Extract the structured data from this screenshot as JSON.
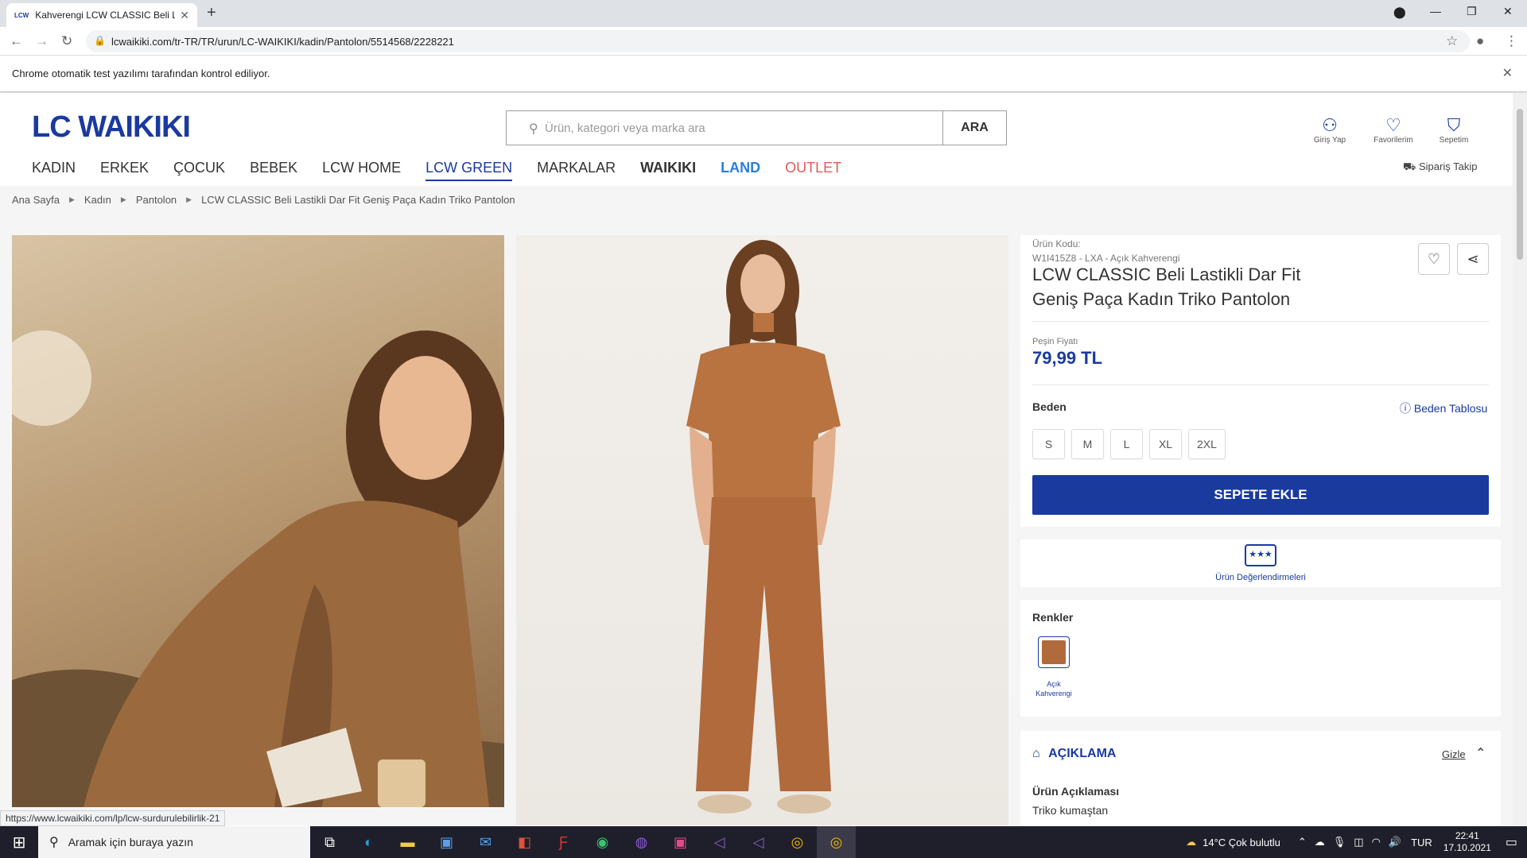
{
  "browser": {
    "tab_title": "Kahverengi LCW CLASSIC Beli La",
    "tab_favicon": "LCW",
    "url": "lcwaikiki.com/tr-TR/TR/urun/LC-WAIKIKI/kadin/Pantolon/5514568/2228221",
    "automation_notice": "Chrome otomatik test yazılımı tarafından kontrol ediliyor.",
    "status_url": "https://www.lcwaikiki.com/lp/lcw-surdurulebilirlik-21"
  },
  "header": {
    "logo": "LC WAIKIKI",
    "search_placeholder": "Ürün, kategori veya marka ara",
    "search_button": "ARA",
    "login_label": "Giriş Yap",
    "favorites_label": "Favorilerim",
    "cart_label": "Sepetim",
    "order_track_label": "Sipariş Takip"
  },
  "nav": {
    "items": [
      "KADIN",
      "ERKEK",
      "ÇOCUK",
      "BEBEK",
      "LCW HOME",
      "LCW GREEN",
      "MARKALAR"
    ],
    "waikiki": "WAIKIKI",
    "land": "LAND",
    "outlet": "OUTLET"
  },
  "breadcrumb": [
    "Ana Sayfa",
    "Kadın",
    "Pantolon",
    "LCW CLASSIC Beli Lastikli Dar Fit Geniş Paça Kadın Triko Pantolon"
  ],
  "product": {
    "code_label": "Ürün Kodu:",
    "code_value": "W1I415Z8 - LXA - Açık Kahverengi",
    "title": "LCW CLASSIC Beli Lastikli Dar Fit Geniş Paça Kadın Triko Pantolon",
    "price_label": "Peşin Fiyatı",
    "price": "79,99 TL",
    "size_label": "Beden",
    "size_table": "Beden Tablosu",
    "sizes": [
      "S",
      "M",
      "L",
      "XL",
      "2XL"
    ],
    "add_to_cart": "SEPETE EKLE",
    "reviews_label": "Ürün Değerlendirmeleri",
    "colors_label": "Renkler",
    "color_name_1": "Açık",
    "color_name_2": "Kahverengi",
    "swatch_color": "#b06a3c",
    "description_title": "AÇIKLAMA",
    "hide_label": "Gizle",
    "description_heading": "Ürün Açıklaması",
    "description_text": "Triko kumaştan"
  },
  "taskbar": {
    "search_placeholder": "Aramak için buraya yazın",
    "weather": "14°C  Çok bulutlu",
    "lang": "TUR",
    "time": "22:41",
    "date": "17.10.2021"
  },
  "colors": {
    "brand_blue": "#1a3aa0",
    "button_blue": "#1b3a9e",
    "outlet_red": "#e05a5a"
  }
}
